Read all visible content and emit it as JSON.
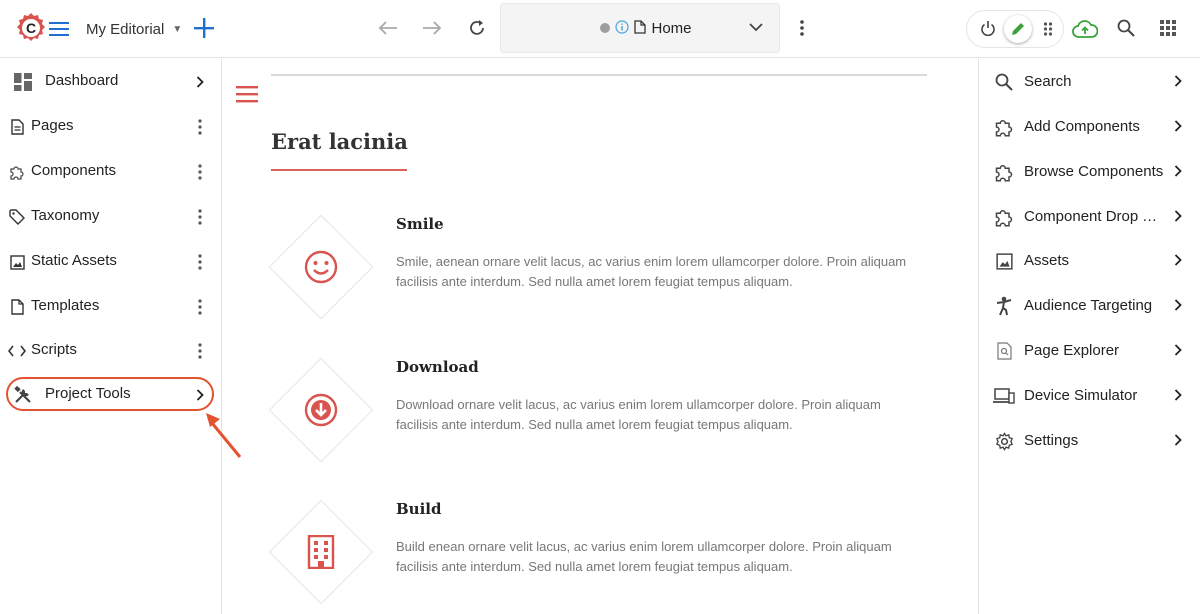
{
  "colors": {
    "accent_red": "#d9534f",
    "highlight_orange": "#e2532f",
    "brand_blue": "#1f6fd0",
    "edit_green": "#3aa23a"
  },
  "topbar": {
    "site_name": "My Editorial",
    "address_page": "Home",
    "icons": [
      "logo-icon",
      "hamburger-icon",
      "plus-icon",
      "back-arrow-icon",
      "forward-arrow-icon",
      "reload-icon",
      "page-icon",
      "chevron-down-icon",
      "kebab-icon",
      "power-icon",
      "pencil-icon",
      "drag-dots-icon",
      "cloud-upload-icon",
      "search-icon",
      "apps-grid-icon"
    ]
  },
  "left_nav": {
    "items": [
      {
        "label": "Dashboard",
        "icon": "dashboard-icon",
        "end": "chevron"
      },
      {
        "label": "Pages",
        "icon": "page-icon",
        "end": "kebab"
      },
      {
        "label": "Components",
        "icon": "puzzle-icon",
        "end": "kebab"
      },
      {
        "label": "Taxonomy",
        "icon": "tag-icon",
        "end": "kebab"
      },
      {
        "label": "Static Assets",
        "icon": "image-icon",
        "end": "kebab"
      },
      {
        "label": "Templates",
        "icon": "file-icon",
        "end": "kebab"
      },
      {
        "label": "Scripts",
        "icon": "code-icon",
        "end": "kebab"
      },
      {
        "label": "Project Tools",
        "icon": "tools-icon",
        "end": "chevron"
      }
    ]
  },
  "main": {
    "section_title": "Erat lacinia",
    "features": [
      {
        "title": "Smile",
        "icon": "smile-icon",
        "description": "Smile, aenean ornare velit lacus, ac varius enim lorem ullamcorper dolore. Proin aliquam facilisis ante interdum. Sed nulla amet lorem feugiat tempus aliquam."
      },
      {
        "title": "Download",
        "icon": "download-icon",
        "description": "Download ornare velit lacus, ac varius enim lorem ullamcorper dolore. Proin aliquam facilisis ante interdum. Sed nulla amet lorem feugiat tempus aliquam."
      },
      {
        "title": "Build",
        "icon": "building-icon",
        "description": "Build enean ornare velit lacus, ac varius enim lorem ullamcorper dolore. Proin aliquam facilisis ante interdum. Sed nulla amet lorem feugiat tempus aliquam."
      }
    ]
  },
  "right_nav": {
    "items": [
      {
        "label": "Search",
        "icon": "search-icon"
      },
      {
        "label": "Add Components",
        "icon": "puzzle-icon"
      },
      {
        "label": "Browse Components",
        "icon": "puzzle-icon"
      },
      {
        "label": "Component Drop Targets",
        "icon": "puzzle-icon"
      },
      {
        "label": "Assets",
        "icon": "image-icon"
      },
      {
        "label": "Audience Targeting",
        "icon": "person-icon"
      },
      {
        "label": "Page Explorer",
        "icon": "page-search-icon"
      },
      {
        "label": "Device Simulator",
        "icon": "devices-icon"
      },
      {
        "label": "Settings",
        "icon": "gear-icon"
      }
    ]
  }
}
